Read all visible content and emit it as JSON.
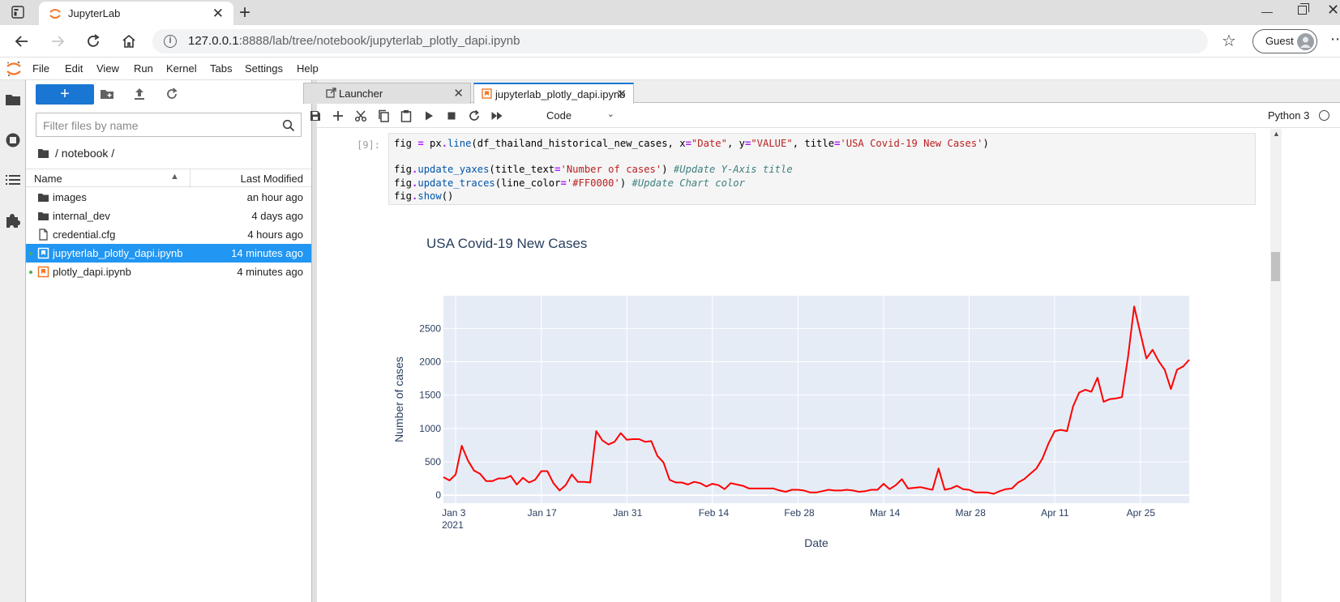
{
  "browser": {
    "tab_title": "JupyterLab",
    "new_tab_label": "+",
    "url_host": "127.0.0.1",
    "url_rest": ":8888/lab/tree/notebook/jupyterlab_plotly_dapi.ipynb",
    "profile_label": "Guest",
    "more_label": "⋯"
  },
  "menu": {
    "items": [
      "File",
      "Edit",
      "View",
      "Run",
      "Kernel",
      "Tabs",
      "Settings",
      "Help"
    ]
  },
  "filebrowser": {
    "new_label": "+",
    "filter_placeholder": "Filter files by name",
    "breadcrumb": "/ notebook /",
    "col_name": "Name",
    "col_modified": "Last Modified",
    "files": [
      {
        "name": "images",
        "modified": "an hour ago",
        "icon": "folder-icon"
      },
      {
        "name": "internal_dev",
        "modified": "4 days ago",
        "icon": "folder-icon"
      },
      {
        "name": "credential.cfg",
        "modified": "4 hours ago",
        "icon": "file-icon"
      },
      {
        "name": "jupyterlab_plotly_dapi.ipynb",
        "modified": "14 minutes ago",
        "icon": "notebook-icon"
      },
      {
        "name": "plotly_dapi.ipynb",
        "modified": "4 minutes ago",
        "icon": "notebook-icon"
      }
    ]
  },
  "tabs": [
    {
      "label": "Launcher",
      "icon": "launcher-icon"
    },
    {
      "label": "jupyterlab_plotly_dapi.ipynb",
      "icon": "notebook-icon"
    }
  ],
  "notebook": {
    "cell_type": "Code",
    "kernel": "Python 3",
    "prompt": "[9]:",
    "code_lines": [
      [
        [
          "var",
          "fig "
        ],
        [
          "op",
          "="
        ],
        [
          "var",
          " px"
        ],
        [
          "op",
          "."
        ],
        [
          "prop",
          "line"
        ],
        [
          "var",
          "(df_thailand_historical_new_cases, x"
        ],
        [
          "op",
          "="
        ],
        [
          "str",
          "\"Date\""
        ],
        [
          "var",
          ", y"
        ],
        [
          "op",
          "="
        ],
        [
          "str",
          "\"VALUE\""
        ],
        [
          "var",
          ", title"
        ],
        [
          "op",
          "="
        ],
        [
          "str",
          "'USA Covid-19 New Cases'"
        ],
        [
          "var",
          ")"
        ]
      ],
      [],
      [
        [
          "var",
          "fig"
        ],
        [
          "op",
          "."
        ],
        [
          "prop",
          "update_yaxes"
        ],
        [
          "var",
          "(title_text"
        ],
        [
          "op",
          "="
        ],
        [
          "str",
          "'Number of cases'"
        ],
        [
          "var",
          ") "
        ],
        [
          "com",
          "#Update Y-Axis title"
        ]
      ],
      [
        [
          "var",
          "fig"
        ],
        [
          "op",
          "."
        ],
        [
          "prop",
          "update_traces"
        ],
        [
          "var",
          "(line_color"
        ],
        [
          "op",
          "="
        ],
        [
          "str",
          "'#FF0000'"
        ],
        [
          "var",
          ") "
        ],
        [
          "com",
          "#Update Chart color"
        ]
      ],
      [
        [
          "var",
          "fig"
        ],
        [
          "op",
          "."
        ],
        [
          "prop",
          "show"
        ],
        [
          "var",
          "()"
        ]
      ]
    ]
  },
  "colors": {
    "accent": "#1976d2",
    "selected_row": "#2196f3",
    "line": "#ff0000",
    "plot_bg": "#e5ecf6",
    "jupyter_orange": "#f37726"
  },
  "chart_data": {
    "type": "line",
    "title": "USA Covid-19 New Cases",
    "xlabel": "Date",
    "ylabel": "Number of cases",
    "x_start": "2021-01-01",
    "x_end": "2021-05-03",
    "ylim": [
      -120,
      2990
    ],
    "grid": true,
    "x_ticks": [
      {
        "date": "2021-01-03",
        "label": "Jan 3",
        "sub": "2021"
      },
      {
        "date": "2021-01-17",
        "label": "Jan 17"
      },
      {
        "date": "2021-01-31",
        "label": "Jan 31"
      },
      {
        "date": "2021-02-14",
        "label": "Feb 14"
      },
      {
        "date": "2021-02-28",
        "label": "Feb 28"
      },
      {
        "date": "2021-03-14",
        "label": "Mar 14"
      },
      {
        "date": "2021-03-28",
        "label": "Mar 28"
      },
      {
        "date": "2021-04-11",
        "label": "Apr 11"
      },
      {
        "date": "2021-04-25",
        "label": "Apr 25"
      }
    ],
    "y_ticks": [
      0,
      500,
      1000,
      1500,
      2000,
      2500
    ],
    "series": [
      {
        "x": [
          "2021-01-01",
          "2021-01-02",
          "2021-01-03",
          "2021-01-04",
          "2021-01-05",
          "2021-01-06",
          "2021-01-07",
          "2021-01-08",
          "2021-01-09",
          "2021-01-10",
          "2021-01-11",
          "2021-01-12",
          "2021-01-13",
          "2021-01-14",
          "2021-01-15",
          "2021-01-16",
          "2021-01-17",
          "2021-01-18",
          "2021-01-19",
          "2021-01-20",
          "2021-01-21",
          "2021-01-22",
          "2021-01-23",
          "2021-01-24",
          "2021-01-25",
          "2021-01-26",
          "2021-01-27",
          "2021-01-28",
          "2021-01-29",
          "2021-01-30",
          "2021-01-31",
          "2021-02-01",
          "2021-02-02",
          "2021-02-03",
          "2021-02-04",
          "2021-02-05",
          "2021-02-06",
          "2021-02-07",
          "2021-02-08",
          "2021-02-09",
          "2021-02-10",
          "2021-02-11",
          "2021-02-12",
          "2021-02-13",
          "2021-02-14",
          "2021-02-15",
          "2021-02-16",
          "2021-02-17",
          "2021-02-18",
          "2021-02-19",
          "2021-02-20",
          "2021-02-21",
          "2021-02-22",
          "2021-02-23",
          "2021-02-24",
          "2021-02-25",
          "2021-02-26",
          "2021-02-27",
          "2021-02-28",
          "2021-03-01",
          "2021-03-02",
          "2021-03-03",
          "2021-03-04",
          "2021-03-05",
          "2021-03-06",
          "2021-03-07",
          "2021-03-08",
          "2021-03-09",
          "2021-03-10",
          "2021-03-11",
          "2021-03-12",
          "2021-03-13",
          "2021-03-14",
          "2021-03-15",
          "2021-03-16",
          "2021-03-17",
          "2021-03-18",
          "2021-03-19",
          "2021-03-20",
          "2021-03-21",
          "2021-03-22",
          "2021-03-23",
          "2021-03-24",
          "2021-03-25",
          "2021-03-26",
          "2021-03-27",
          "2021-03-28",
          "2021-03-29",
          "2021-03-30",
          "2021-03-31",
          "2021-04-01",
          "2021-04-02",
          "2021-04-03",
          "2021-04-04",
          "2021-04-05",
          "2021-04-06",
          "2021-04-07",
          "2021-04-08",
          "2021-04-09",
          "2021-04-10",
          "2021-04-11",
          "2021-04-12",
          "2021-04-13",
          "2021-04-14",
          "2021-04-15",
          "2021-04-16",
          "2021-04-17",
          "2021-04-18",
          "2021-04-19",
          "2021-04-20",
          "2021-04-21",
          "2021-04-22",
          "2021-04-23",
          "2021-04-24",
          "2021-04-25",
          "2021-04-26",
          "2021-04-27",
          "2021-04-28",
          "2021-04-29",
          "2021-04-30",
          "2021-05-01",
          "2021-05-02",
          "2021-05-03"
        ],
        "values": [
          270,
          220,
          310,
          740,
          520,
          370,
          320,
          210,
          210,
          250,
          250,
          290,
          160,
          260,
          190,
          230,
          360,
          360,
          180,
          70,
          150,
          310,
          200,
          200,
          190,
          960,
          820,
          760,
          800,
          930,
          830,
          840,
          840,
          800,
          810,
          590,
          490,
          230,
          190,
          190,
          160,
          200,
          180,
          130,
          170,
          150,
          90,
          180,
          160,
          140,
          100,
          100,
          100,
          100,
          100,
          70,
          50,
          80,
          80,
          70,
          40,
          40,
          60,
          80,
          70,
          70,
          80,
          70,
          50,
          60,
          80,
          80,
          170,
          90,
          150,
          240,
          100,
          110,
          120,
          100,
          80,
          400,
          80,
          100,
          140,
          90,
          80,
          40,
          40,
          40,
          20,
          60,
          90,
          100,
          190,
          240,
          320,
          400,
          550,
          780,
          960,
          980,
          960,
          1330,
          1540,
          1580,
          1550,
          1760,
          1400,
          1440,
          1450,
          1470,
          2080,
          2830,
          2430,
          2050,
          2180,
          2010,
          1880,
          1590,
          1880,
          1930,
          2030
        ]
      }
    ]
  }
}
